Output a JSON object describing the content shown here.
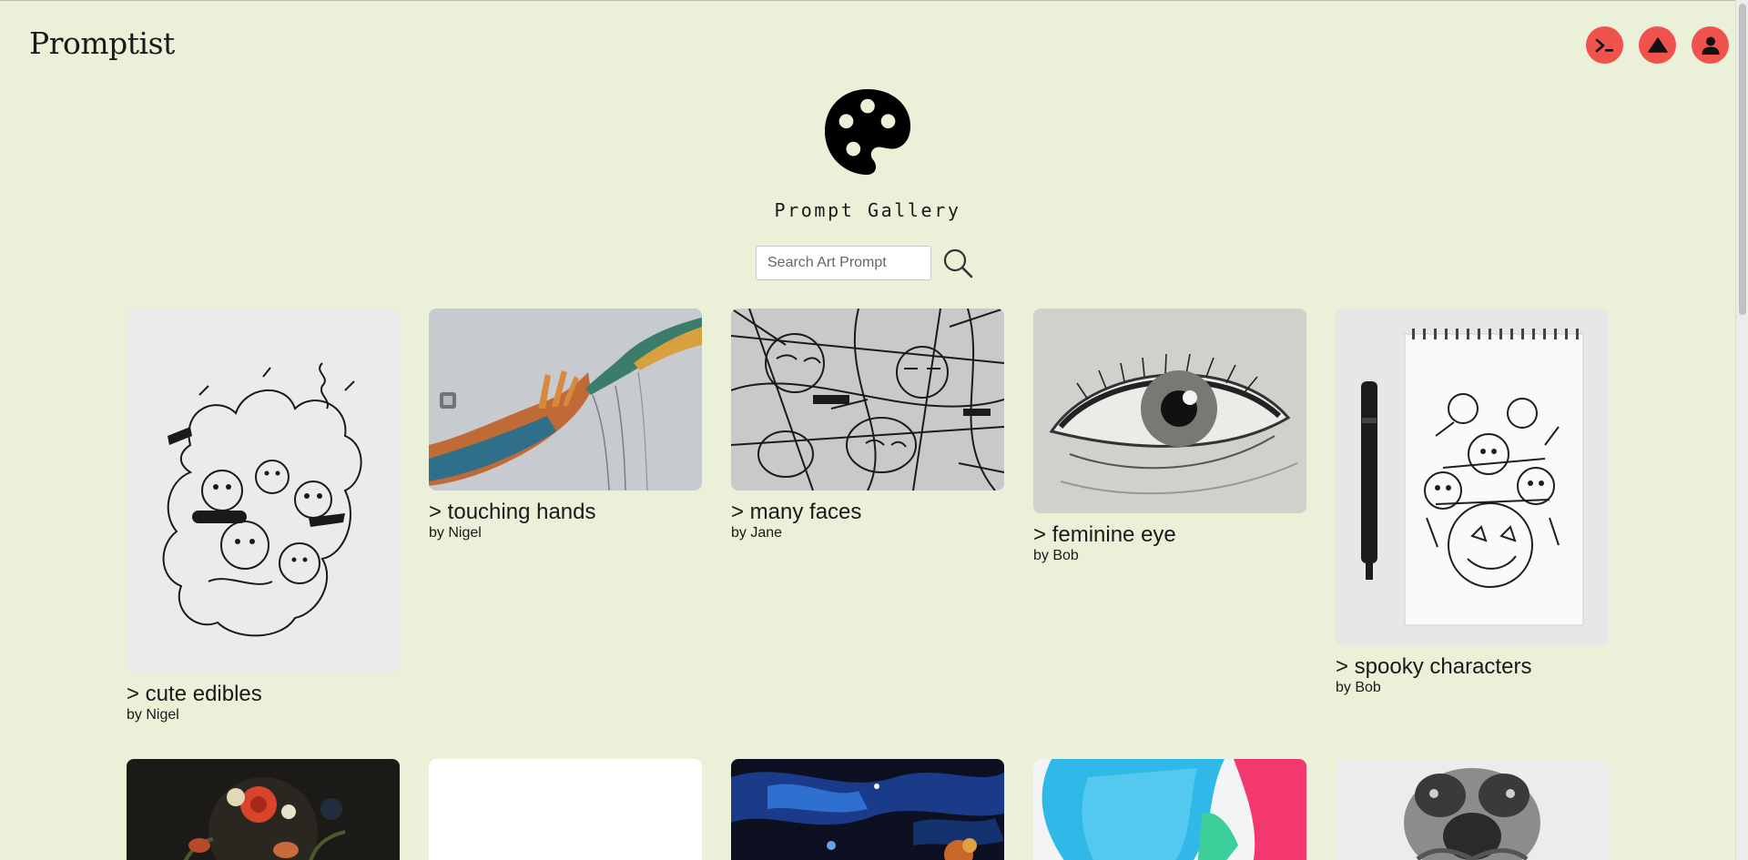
{
  "app": {
    "brand": "Promptist"
  },
  "header": {
    "actions": [
      {
        "icon": "terminal-icon"
      },
      {
        "icon": "triangle-icon"
      },
      {
        "icon": "user-icon"
      }
    ],
    "accent_color": "#f0534e"
  },
  "hero": {
    "title": "Prompt Gallery",
    "icon": "palette-icon"
  },
  "search": {
    "placeholder": "Search Art Prompt",
    "value": ""
  },
  "gallery": {
    "cards": [
      {
        "title": "> cute edibles",
        "author": "by Nigel",
        "image": "doodle-characters-drawing"
      },
      {
        "title": "> touching hands",
        "author": "by Nigel",
        "image": "painted-hands-reaching"
      },
      {
        "title": "> many faces",
        "author": "by Jane",
        "image": "abstract-line-faces"
      },
      {
        "title": "> feminine eye",
        "author": "by Bob",
        "image": "pencil-eye-sketch"
      },
      {
        "title": "> spooky characters",
        "author": "by Bob",
        "image": "halloween-sketchbook-with-pen"
      },
      {
        "title": "",
        "author": "",
        "image": "dark-floral-painting"
      },
      {
        "title": "",
        "author": "",
        "image": "white-canvas"
      },
      {
        "title": "",
        "author": "",
        "image": "dark-blue-fluid-art"
      },
      {
        "title": "",
        "author": "",
        "image": "cyan-pink-abstract"
      },
      {
        "title": "",
        "author": "",
        "image": "grayscale-figures"
      }
    ]
  },
  "colors": {
    "background": "#ebf0d8",
    "accent": "#f0534e"
  }
}
